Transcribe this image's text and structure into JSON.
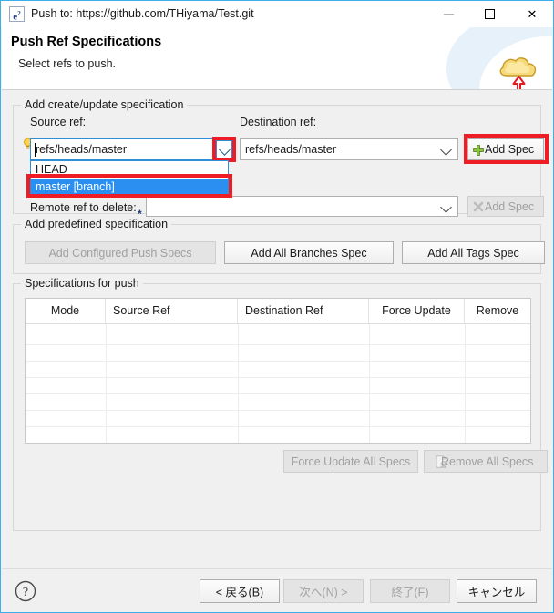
{
  "window": {
    "icon_name": "eclipse-icon",
    "icon_text": "e",
    "icon_sup": "2",
    "title": "Push to: https://github.com/THiyama/Test.git",
    "controls": {
      "minimize": "minimize-icon",
      "maximize": "maximize-icon",
      "close": "close-icon"
    }
  },
  "header": {
    "title": "Push Ref Specifications",
    "subtitle": "Select refs to push.",
    "banner_icon": "cloud-push-icon"
  },
  "create_group": {
    "title": "Add create/update specification",
    "source_label": "Source ref:",
    "source_value": "refs/heads/master",
    "source_hint_icon": "lightbulb-icon",
    "dropdown_open": true,
    "dropdown_items": [
      {
        "label": "HEAD",
        "selected": false
      },
      {
        "label": "master [branch]",
        "selected": true
      }
    ],
    "destination_label": "Destination ref:",
    "destination_value": "refs/heads/master",
    "add_spec_label": "Add Spec",
    "add_spec_icon": "green-plus-icon",
    "remote_delete_label": "Remote ref to delete:",
    "remote_delete_value": "",
    "remote_delete_marker": "*",
    "delete_spec_label": "Add Spec",
    "delete_spec_icon": "gray-x-icon",
    "delete_spec_disabled": true
  },
  "predefined_group": {
    "title": "Add predefined specification",
    "buttons": [
      {
        "label": "Add Configured Push Specs",
        "disabled": true
      },
      {
        "label": "Add All Branches Spec",
        "disabled": false
      },
      {
        "label": "Add All Tags Spec",
        "disabled": false
      }
    ]
  },
  "specs_group": {
    "title": "Specifications for push",
    "columns": [
      "Mode",
      "Source Ref",
      "Destination Ref",
      "Force Update",
      "Remove"
    ],
    "rows": [],
    "force_update_all_label": "Force Update All Specs",
    "force_update_all_disabled": true,
    "remove_all_label": "Remove All Specs",
    "remove_all_icon": "remove-document-icon",
    "remove_all_disabled": true
  },
  "footer": {
    "help_icon": "help-icon",
    "buttons": [
      {
        "label": "< 戻る(B)",
        "disabled": false
      },
      {
        "label": "次へ(N) >",
        "disabled": true
      },
      {
        "label": "終了(F)",
        "disabled": true
      },
      {
        "label": "キャンセル",
        "disabled": false
      }
    ]
  },
  "colors": {
    "annotation_red": "#ee1c25",
    "selection_blue": "#2a8ff0",
    "focus_border": "#2f8fd6",
    "window_border": "#3daee9",
    "dialog_bg": "#f0f0f0"
  }
}
